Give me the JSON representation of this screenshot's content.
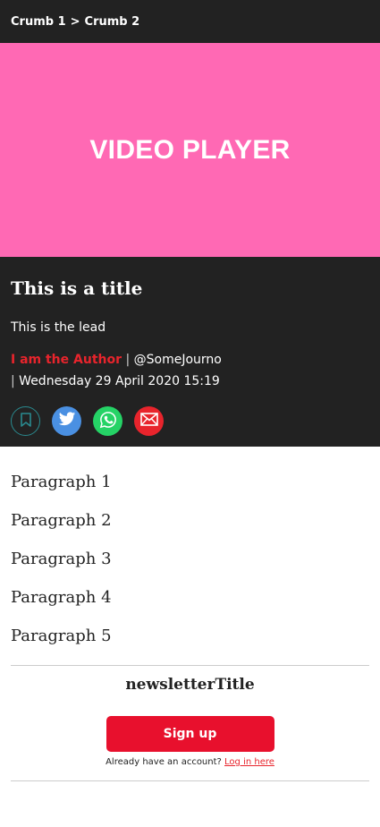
{
  "breadcrumb": {
    "items": [
      "Crumb 1",
      "Crumb 2"
    ],
    "separator": ">"
  },
  "video": {
    "label": "VIDEO PLAYER",
    "background": "#ff69b4"
  },
  "article": {
    "title": "This is a title",
    "lead": "This is the lead",
    "author": "I am the Author",
    "handle": "@SomeJourno",
    "date": "Wednesday 29 April 2020 15:19",
    "meta_separator": "|"
  },
  "share": {
    "buttons": [
      {
        "name": "bookmark",
        "icon": "bookmark-icon",
        "color": "#2a8a8f"
      },
      {
        "name": "twitter",
        "icon": "twitter-icon",
        "color": "#4a90e2"
      },
      {
        "name": "whatsapp",
        "icon": "whatsapp-icon",
        "color": "#25d366"
      },
      {
        "name": "email",
        "icon": "email-icon",
        "color": "#e8242c"
      }
    ]
  },
  "paragraphs": [
    "Paragraph 1",
    "Paragraph 2",
    "Paragraph 3",
    "Paragraph 4",
    "Paragraph 5"
  ],
  "newsletter": {
    "title": "newsletterTitle",
    "signup_label": "Sign up",
    "login_prompt": "Already have an account?",
    "login_link": "Log in here"
  },
  "colors": {
    "header_background": "#222222",
    "accent_red": "#e8242c"
  }
}
